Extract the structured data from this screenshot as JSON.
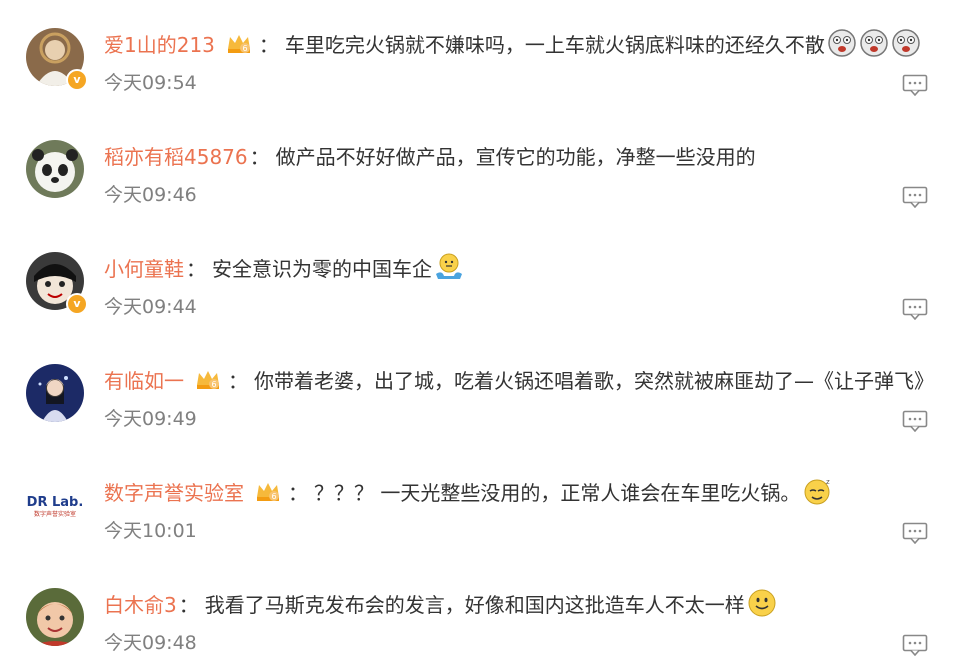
{
  "comments": [
    {
      "username": "爱1山的213",
      "text": "车里吃完火锅就不嫌味吗，一上车就火锅底料味的还经久不散",
      "time": "今天09:54",
      "emoji": "dizzy-face-icon"
    },
    {
      "username": "稻亦有稻45876",
      "text": "做产品不好好做产品，宣传它的功能，净整一些没用的",
      "time": "今天09:46"
    },
    {
      "username": "小何童鞋",
      "text": "安全意识为零的中国车企",
      "time": "今天09:44",
      "emoji": "shrug-icon"
    },
    {
      "username": "有临如一",
      "text": "你带着老婆，出了城，吃着火锅还唱着歌，突然就被麻匪劫了—《让子弹飞》",
      "time": "今天09:49"
    },
    {
      "username": "数字声誉实验室",
      "text": "？？？ 一天光整些没用的，正常人谁会在车里吃火锅。",
      "time": "今天10:01",
      "emoji": "sleepy-face-icon",
      "avatar_text": "DR Lab.",
      "avatar_subtext": "数字声誉实验室"
    },
    {
      "username": "白木俞3",
      "text": "我看了马斯克发布会的发言，好像和国内这批造车人不太一样",
      "time": "今天09:48",
      "emoji": "smile-icon"
    }
  ],
  "colon": "：",
  "badge_char": "v",
  "crown_level": "6",
  "colors": {
    "username": "#eb7350",
    "time": "#808080",
    "text": "#333333",
    "badge": "#f5a623"
  }
}
